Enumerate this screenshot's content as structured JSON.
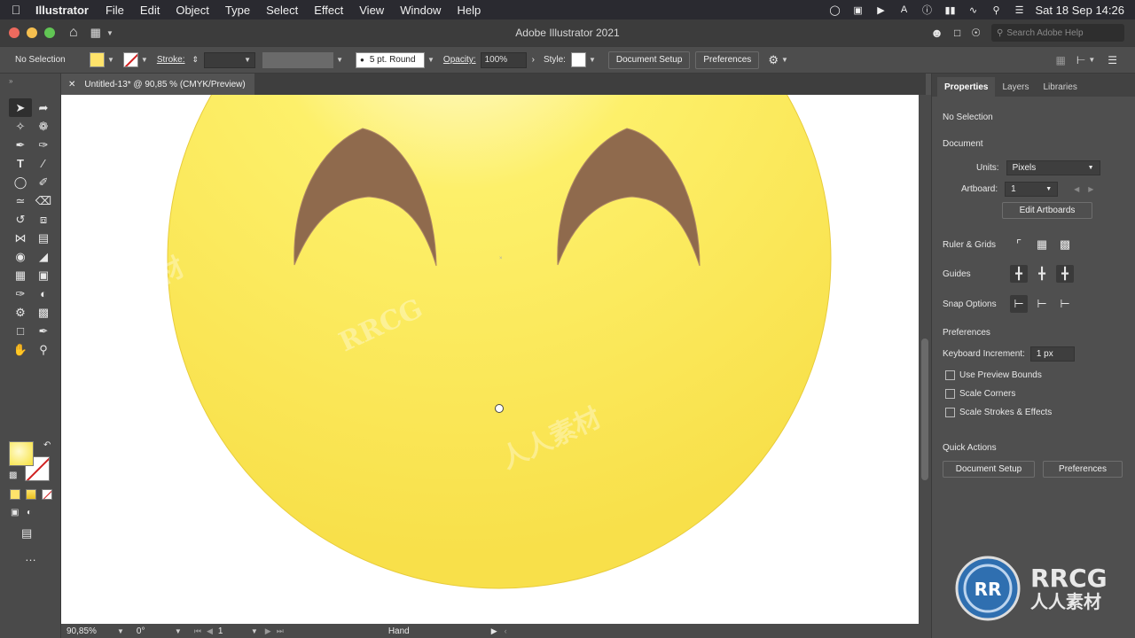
{
  "menubar": {
    "app_name": "Illustrator",
    "menus": [
      "File",
      "Edit",
      "Object",
      "Type",
      "Select",
      "Effect",
      "View",
      "Window",
      "Help"
    ],
    "clock": "Sat 18 Sep  14:26"
  },
  "titlebar": {
    "title": "Adobe Illustrator 2021",
    "search_placeholder": "Search Adobe Help"
  },
  "controlbar": {
    "selection": "No Selection",
    "stroke_label": "Stroke:",
    "brush": "5 pt. Round",
    "opacity_label": "Opacity:",
    "opacity_value": "100%",
    "style_label": "Style:",
    "document_setup": "Document Setup",
    "preferences": "Preferences"
  },
  "document": {
    "tab_title": "Untitled-13* @ 90,85 % (CMYK/Preview)"
  },
  "statusbar": {
    "zoom": "90,85%",
    "rotation": "0°",
    "artboard": "1",
    "tool": "Hand"
  },
  "panel": {
    "tabs": [
      "Properties",
      "Layers",
      "Libraries"
    ],
    "selection": "No Selection",
    "document_heading": "Document",
    "units_label": "Units:",
    "units_value": "Pixels",
    "artboard_label": "Artboard:",
    "artboard_value": "1",
    "edit_artboards": "Edit Artboards",
    "ruler_grids": "Ruler & Grids",
    "guides": "Guides",
    "snap_options": "Snap Options",
    "preferences_heading": "Preferences",
    "keyboard_increment_label": "Keyboard Increment:",
    "keyboard_increment_value": "1 px",
    "checkboxes": [
      "Use Preview Bounds",
      "Scale Corners",
      "Scale Strokes & Effects"
    ],
    "quick_actions": "Quick Actions",
    "document_setup": "Document Setup",
    "preferences": "Preferences"
  },
  "colors": {
    "face_yellow": "#f8e04a",
    "face_highlight": "#fffde6",
    "eye_brown": "#8f6a4d",
    "ui_dark": "#4d4d4d"
  },
  "watermark": {
    "brand": "RRCG",
    "brand_cn": "人人素材"
  }
}
